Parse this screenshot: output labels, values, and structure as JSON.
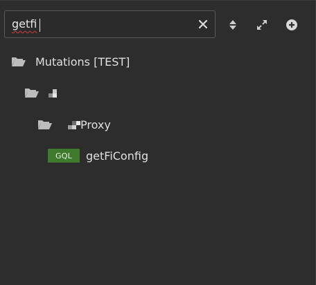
{
  "search": {
    "value": "getfi"
  },
  "toolbar": {
    "clear_icon": "close-icon",
    "sort_icon": "sort-icon",
    "expand_icon": "expand-icon",
    "add_icon": "add-circle-icon"
  },
  "tree": {
    "root": {
      "label": "Mutations [TEST]",
      "icon": "folder-open-icon"
    },
    "subfolder": {
      "label": "",
      "icon": "folder-open-icon"
    },
    "proxy_folder": {
      "label": "Proxy",
      "icon": "folder-open-icon"
    },
    "operation": {
      "badge": "GQL",
      "label": "getFiConfig"
    }
  },
  "colors": {
    "background": "#2d2d2d",
    "badge": "#3f7a2c",
    "text": "#e0e0e0"
  }
}
